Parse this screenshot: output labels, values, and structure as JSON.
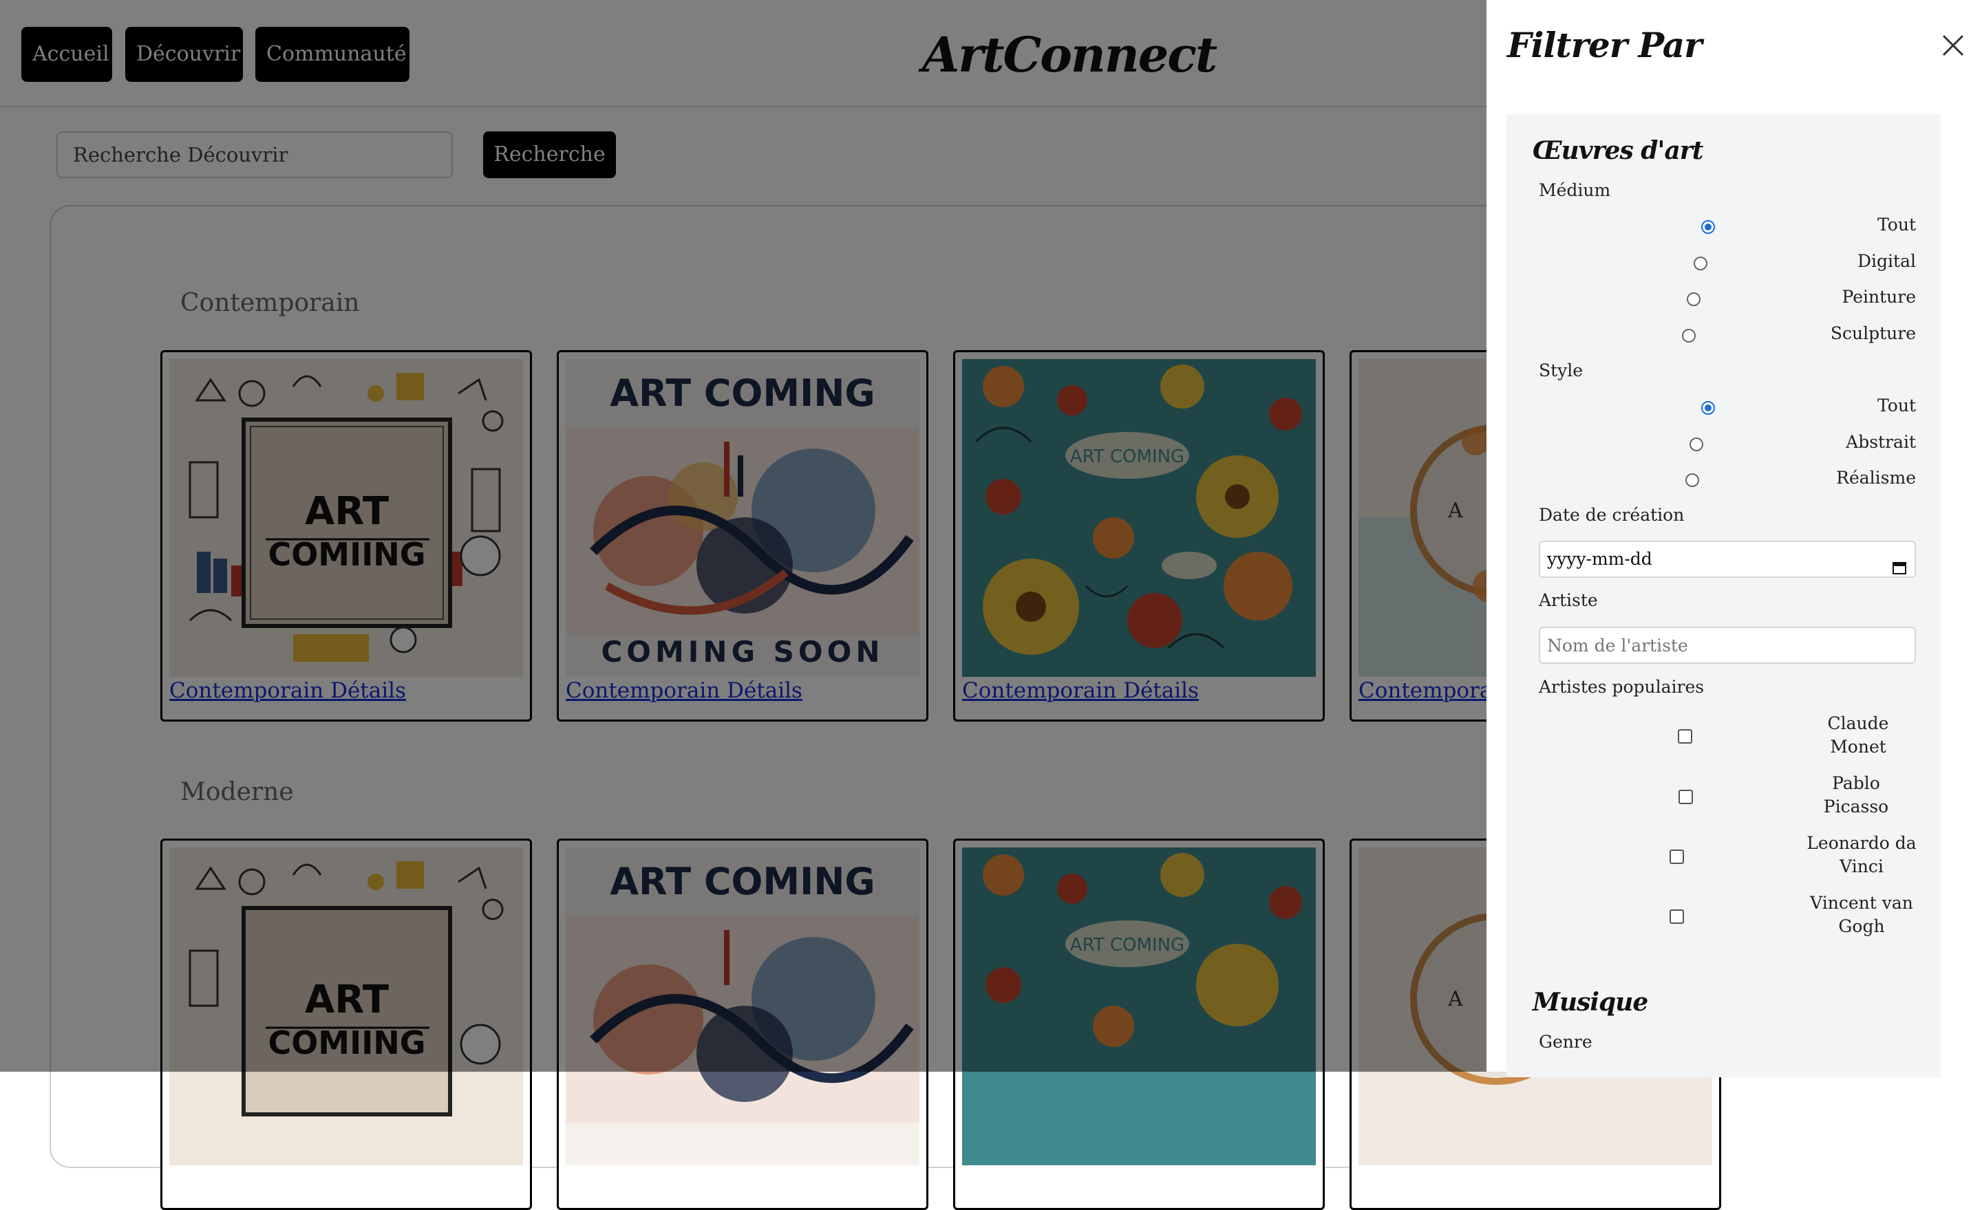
{
  "nav": {
    "items": [
      "Accueil",
      "Découvrir",
      "Communauté"
    ],
    "logo": "ArtConnect"
  },
  "search": {
    "placeholder": "Recherche Découvrir",
    "button": "Recherche"
  },
  "sections": [
    {
      "title": "Contemporain",
      "cards": [
        {
          "link": "Contemporain Détails",
          "art_text": "ART COMIING"
        },
        {
          "link": "Contemporain Détails",
          "art_text": "ART COMING",
          "art_sub": "COMING SOON"
        },
        {
          "link": "Contemporain Détails",
          "art_text": "ART COMING"
        },
        {
          "link": "Contemporain Détails",
          "art_text": "A"
        }
      ]
    },
    {
      "title": "Moderne",
      "cards": [
        {
          "art_text": "ART COMIING"
        },
        {
          "art_text": "ART COMING"
        },
        {
          "art_text": "ART COMING"
        },
        {
          "art_text": "A"
        }
      ]
    }
  ],
  "filter": {
    "title": "Filtrer Par",
    "artworks": {
      "title": "Œuvres d'art",
      "medium_label": "Médium",
      "medium_options": [
        "Tout",
        "Digital",
        "Peinture",
        "Sculpture"
      ],
      "medium_selected": "Tout",
      "style_label": "Style",
      "style_options": [
        "Tout",
        "Abstrait",
        "Réalisme"
      ],
      "style_selected": "Tout",
      "date_label": "Date de création",
      "date_value": "yyyy-mm-dd",
      "artist_label": "Artiste",
      "artist_placeholder": "Nom de l'artiste",
      "popular_label": "Artistes populaires",
      "popular_artists": [
        "Claude Monet",
        "Pablo Picasso",
        "Leonardo da Vinci",
        "Vincent van Gogh"
      ]
    },
    "music": {
      "title": "Musique",
      "genre_label": "Genre"
    }
  },
  "colors": {
    "link": "#1a2fd6",
    "radio_accent": "#1a6fd6",
    "button_bg": "#000000",
    "overlay": "rgba(0,0,0,0.5)"
  }
}
